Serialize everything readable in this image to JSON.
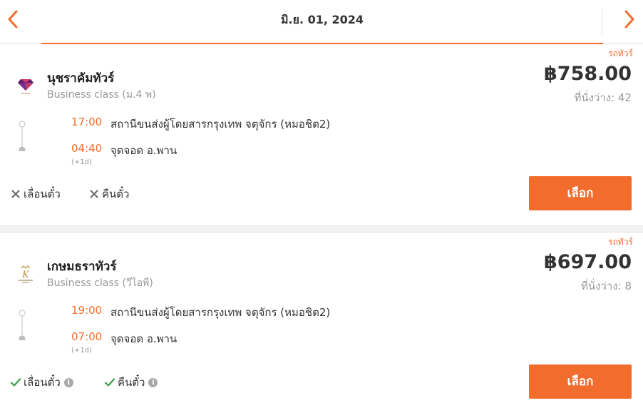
{
  "header": {
    "date": "มิ.ย. 01, 2024",
    "accent_color": "#f26d2d",
    "prev_icon": "chevron-left-icon",
    "next_icon": "chevron-right-icon"
  },
  "trips": [
    {
      "vehicle_type": "รถทัวร์",
      "operator_name": "นุชราคัมทัวร์",
      "bus_class": "Business class (ม.4 พ)",
      "price": "฿758.00",
      "seats_available": "ที่นั่งว่าง: 42",
      "departure_time": "17:00",
      "departure_station": "สถานีขนส่งผู้โดยสารกรุงเทพ จตุจักร (หมอชิต2)",
      "arrival_time": "04:40",
      "arrival_station": "จุดจอด อ.พาน",
      "arrival_day_offset": "(+1d)",
      "reschedule_label": "เลื่อนตั๋ว",
      "reschedule_allowed": false,
      "refund_label": "คืนตั๋ว",
      "refund_allowed": false,
      "select_label": "เลือก"
    },
    {
      "vehicle_type": "รถทัวร์",
      "operator_name": "เกษมธราทัวร์",
      "bus_class": "Business class (วีไอพี)",
      "price": "฿697.00",
      "seats_available": "ที่นั่งว่าง: 8",
      "departure_time": "19:00",
      "departure_station": "สถานีขนส่งผู้โดยสารกรุงเทพ จตุจักร (หมอชิต2)",
      "arrival_time": "07:00",
      "arrival_station": "จุดจอด อ.พาน",
      "arrival_day_offset": "(+1d)",
      "reschedule_label": "เลื่อนตั๋ว",
      "reschedule_allowed": true,
      "refund_label": "คืนตั๋ว",
      "refund_allowed": true,
      "info_icon_glyph": "i",
      "select_label": "เลือก"
    }
  ]
}
